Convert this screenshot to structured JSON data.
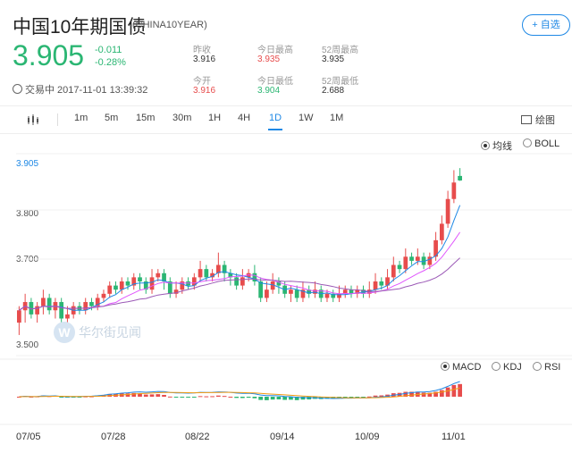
{
  "header": {
    "title": "中国10年期国债",
    "code": "(CHINA10YEAR)",
    "watch_label": "+ 自选",
    "price": "3.905",
    "change": "-0.011",
    "change_pct": "-0.28%",
    "status": "交易中 2017-11-01 13:39:32",
    "stats": [
      {
        "label": "昨收",
        "value": "3.916"
      },
      {
        "label": "今日最高",
        "value": "3.935"
      },
      {
        "label": "52周最高",
        "value": "3.935"
      },
      {
        "label": "今开",
        "value": "3.916"
      },
      {
        "label": "今日最低",
        "value": "3.904"
      },
      {
        "label": "52周最低",
        "value": "2.688"
      }
    ]
  },
  "toolbar": {
    "periods": [
      "1m",
      "5m",
      "15m",
      "30m",
      "1H",
      "4H",
      "1D",
      "1W",
      "1M"
    ],
    "active": "1D",
    "draw_label": "绘图",
    "main_indicators": [
      "均线",
      "BOLL"
    ],
    "main_selected": "均线",
    "sub_indicators": [
      "MACD",
      "KDJ",
      "RSI"
    ],
    "sub_selected": "MACD"
  },
  "watermark": "华尔街见闻",
  "colors": {
    "up": "#e74c4c",
    "down": "#2bb673",
    "accent": "#1e88e5"
  },
  "chart_data": {
    "type": "candlestick",
    "y_ticks": [
      "3.905",
      "3.800",
      "3.700",
      "3.500"
    ],
    "x_ticks": [
      "07/05",
      "07/28",
      "08/22",
      "09/14",
      "10/09",
      "11/01"
    ],
    "ylim": [
      3.48,
      3.97
    ],
    "candles": [
      [
        3.56,
        3.59,
        3.6,
        3.53
      ],
      [
        3.59,
        3.61,
        3.63,
        3.56
      ],
      [
        3.61,
        3.58,
        3.62,
        3.57
      ],
      [
        3.58,
        3.6,
        3.61,
        3.56
      ],
      [
        3.6,
        3.62,
        3.64,
        3.58
      ],
      [
        3.62,
        3.59,
        3.63,
        3.58
      ],
      [
        3.59,
        3.61,
        3.62,
        3.57
      ],
      [
        3.61,
        3.57,
        3.62,
        3.56
      ],
      [
        3.57,
        3.58,
        3.6,
        3.55
      ],
      [
        3.58,
        3.6,
        3.61,
        3.57
      ],
      [
        3.6,
        3.59,
        3.61,
        3.58
      ],
      [
        3.59,
        3.61,
        3.62,
        3.58
      ],
      [
        3.61,
        3.6,
        3.62,
        3.59
      ],
      [
        3.6,
        3.62,
        3.63,
        3.59
      ],
      [
        3.62,
        3.63,
        3.64,
        3.61
      ],
      [
        3.63,
        3.65,
        3.66,
        3.62
      ],
      [
        3.65,
        3.64,
        3.66,
        3.63
      ],
      [
        3.64,
        3.66,
        3.67,
        3.63
      ],
      [
        3.66,
        3.65,
        3.67,
        3.64
      ],
      [
        3.65,
        3.67,
        3.68,
        3.64
      ],
      [
        3.67,
        3.66,
        3.68,
        3.64
      ],
      [
        3.66,
        3.64,
        3.67,
        3.63
      ],
      [
        3.64,
        3.67,
        3.69,
        3.63
      ],
      [
        3.67,
        3.68,
        3.69,
        3.66
      ],
      [
        3.68,
        3.66,
        3.69,
        3.64
      ],
      [
        3.66,
        3.63,
        3.67,
        3.62
      ],
      [
        3.63,
        3.64,
        3.66,
        3.62
      ],
      [
        3.64,
        3.66,
        3.67,
        3.63
      ],
      [
        3.66,
        3.65,
        3.67,
        3.64
      ],
      [
        3.65,
        3.67,
        3.68,
        3.64
      ],
      [
        3.67,
        3.69,
        3.71,
        3.66
      ],
      [
        3.69,
        3.67,
        3.7,
        3.66
      ],
      [
        3.67,
        3.68,
        3.69,
        3.66
      ],
      [
        3.68,
        3.7,
        3.73,
        3.67
      ],
      [
        3.7,
        3.68,
        3.71,
        3.66
      ],
      [
        3.68,
        3.67,
        3.69,
        3.65
      ],
      [
        3.67,
        3.65,
        3.68,
        3.64
      ],
      [
        3.65,
        3.67,
        3.69,
        3.64
      ],
      [
        3.67,
        3.68,
        3.69,
        3.66
      ],
      [
        3.68,
        3.66,
        3.7,
        3.65
      ],
      [
        3.66,
        3.62,
        3.67,
        3.61
      ],
      [
        3.62,
        3.64,
        3.66,
        3.61
      ],
      [
        3.64,
        3.66,
        3.68,
        3.63
      ],
      [
        3.66,
        3.65,
        3.67,
        3.63
      ],
      [
        3.65,
        3.63,
        3.66,
        3.62
      ],
      [
        3.63,
        3.64,
        3.65,
        3.61
      ],
      [
        3.64,
        3.62,
        3.65,
        3.61
      ],
      [
        3.62,
        3.64,
        3.66,
        3.61
      ],
      [
        3.64,
        3.63,
        3.65,
        3.62
      ],
      [
        3.63,
        3.64,
        3.66,
        3.62
      ],
      [
        3.64,
        3.62,
        3.65,
        3.61
      ],
      [
        3.62,
        3.63,
        3.64,
        3.61
      ],
      [
        3.63,
        3.62,
        3.64,
        3.61
      ],
      [
        3.62,
        3.63,
        3.65,
        3.61
      ],
      [
        3.63,
        3.64,
        3.65,
        3.62
      ],
      [
        3.64,
        3.63,
        3.65,
        3.62
      ],
      [
        3.63,
        3.64,
        3.65,
        3.62
      ],
      [
        3.64,
        3.63,
        3.65,
        3.62
      ],
      [
        3.63,
        3.64,
        3.66,
        3.62
      ],
      [
        3.64,
        3.66,
        3.68,
        3.63
      ],
      [
        3.66,
        3.65,
        3.67,
        3.64
      ],
      [
        3.65,
        3.67,
        3.69,
        3.64
      ],
      [
        3.67,
        3.7,
        3.72,
        3.66
      ],
      [
        3.7,
        3.69,
        3.71,
        3.68
      ],
      [
        3.69,
        3.72,
        3.74,
        3.68
      ],
      [
        3.72,
        3.71,
        3.73,
        3.7
      ],
      [
        3.71,
        3.72,
        3.74,
        3.7
      ],
      [
        3.72,
        3.7,
        3.73,
        3.69
      ],
      [
        3.7,
        3.72,
        3.73,
        3.69
      ],
      [
        3.72,
        3.76,
        3.78,
        3.71
      ],
      [
        3.76,
        3.8,
        3.82,
        3.75
      ],
      [
        3.8,
        3.86,
        3.88,
        3.79
      ],
      [
        3.86,
        3.9,
        3.93,
        3.85
      ],
      [
        3.916,
        3.905,
        3.935,
        3.904
      ]
    ],
    "series": [
      {
        "name": "MA5",
        "color": "#1e88e5"
      },
      {
        "name": "MA10",
        "color": "#e056fd"
      },
      {
        "name": "MA20",
        "color": "#9b59b6"
      }
    ],
    "macd_legend": "MACD"
  }
}
